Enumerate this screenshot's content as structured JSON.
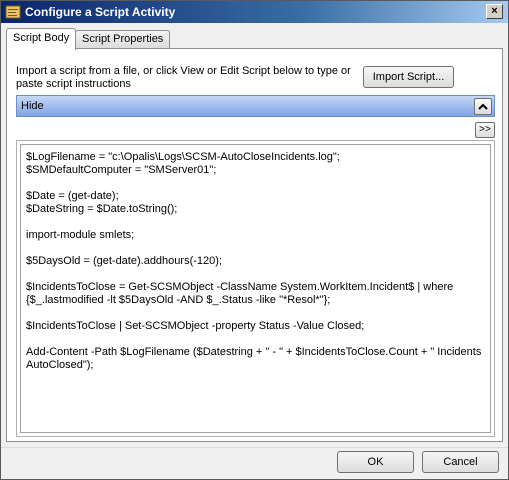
{
  "window": {
    "title": "Configure a Script Activity",
    "close_glyph": "×"
  },
  "tabs": [
    {
      "label": "Script Body",
      "active": true
    },
    {
      "label": "Script Properties",
      "active": false
    }
  ],
  "script_body": {
    "instructions": "Import a script from a file, or click View or Edit Script below to type or paste script instructions",
    "import_button": "Import Script...",
    "section_label": "Hide",
    "expand_button": ">>",
    "script_text": "$LogFilename = \"c:\\Opalis\\Logs\\SCSM-AutoCloseIncidents.log\";\n$SMDefaultComputer = \"SMServer01\";\n\n$Date = (get-date);\n$DateString = $Date.toString();\n\nimport-module smlets;\n\n$5DaysOld = (get-date).addhours(-120);\n\n$IncidentsToClose = Get-SCSMObject -ClassName System.WorkItem.Incident$ | where {$_.lastmodified -lt $5DaysOld -AND $_.Status -like \"*Resol*\"};\n\n$IncidentsToClose | Set-SCSMObject -property Status -Value Closed;\n\nAdd-Content -Path $LogFilename ($Datestring + \" - \" + $IncidentsToClose.Count + \" Incidents AutoClosed\");"
  },
  "footer": {
    "ok_label": "OK",
    "cancel_label": "Cancel"
  },
  "icons": {
    "title_icon": "script-activity-icon",
    "collapse_icon": "chevron-up-icon",
    "close_icon": "close-icon"
  }
}
